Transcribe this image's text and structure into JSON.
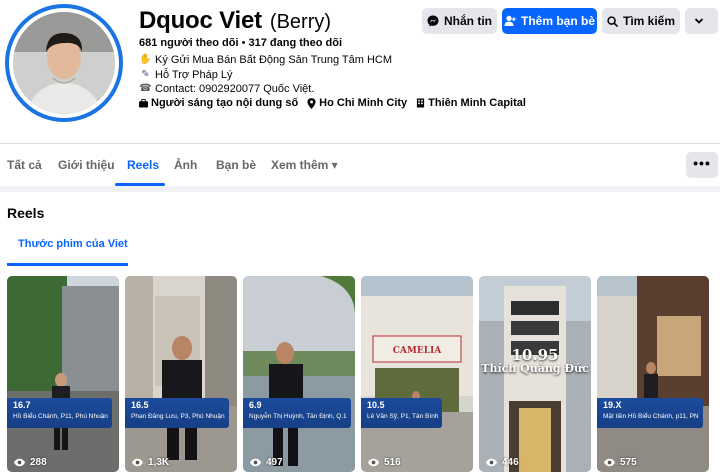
{
  "profile": {
    "name": "Dquoc Viet",
    "alt_name": "(Berry)",
    "followers": "681 người theo dõi",
    "following": "317 đang theo dõi",
    "separator": " • ",
    "bio": [
      {
        "icon": "handshake-icon",
        "text": "Ký Gửi Mua Bán Bất Động Sản Trung Tâm HCM"
      },
      {
        "icon": "pen-icon",
        "text": "Hỗ Trợ Pháp Lý"
      },
      {
        "icon": "phone-icon",
        "text": "Contact: 0902920077 Quốc Việt."
      }
    ],
    "meta": [
      {
        "icon": "briefcase-icon",
        "text": "Người sáng tạo nội dung số"
      },
      {
        "icon": "location-pin-icon",
        "text": "Ho Chi Minh City"
      },
      {
        "icon": "building-icon",
        "text": "Thiên Minh Capital"
      }
    ]
  },
  "actions": {
    "message": "Nhắn tin",
    "add_friend": "Thêm bạn bè",
    "search": "Tìm kiếm"
  },
  "tabs": [
    "Tất cả",
    "Giới thiệu",
    "Reels",
    "Ảnh",
    "Bạn bè",
    "Xem thêm ▾"
  ],
  "active_tab": "Reels",
  "more_label": "•••",
  "reels": {
    "title": "Reels",
    "subtab": "Thước phim của Viet",
    "items": [
      {
        "num": "16.7",
        "address": "Hồ Biểu Chánh, P11, Phú Nhuận",
        "views": "288"
      },
      {
        "num": "16.5",
        "address": "Phan Đăng Lưu, P3, Phú Nhuận",
        "views": "1,3K"
      },
      {
        "num": "6.9",
        "address": "Nguyễn Thị Huỳnh, Tân Định, Q.1",
        "views": "497"
      },
      {
        "num": "10.5",
        "address": "Lê Văn Sỹ, P1, Tân Bình",
        "views": "516"
      },
      {
        "num": "",
        "address": "",
        "views": "446",
        "overlay_price": "10.95",
        "overlay_street": "Thích Quảng Đức"
      },
      {
        "num": "19.X",
        "address": "Mặt tiền Hồ Biểu Chánh, p11, PN",
        "views": "575"
      }
    ],
    "camelia_sign": "CAMELIA"
  },
  "colors": {
    "accent": "#0866ff",
    "avatar_ring": "#1b74e4",
    "badge": "#1c4b9c"
  }
}
